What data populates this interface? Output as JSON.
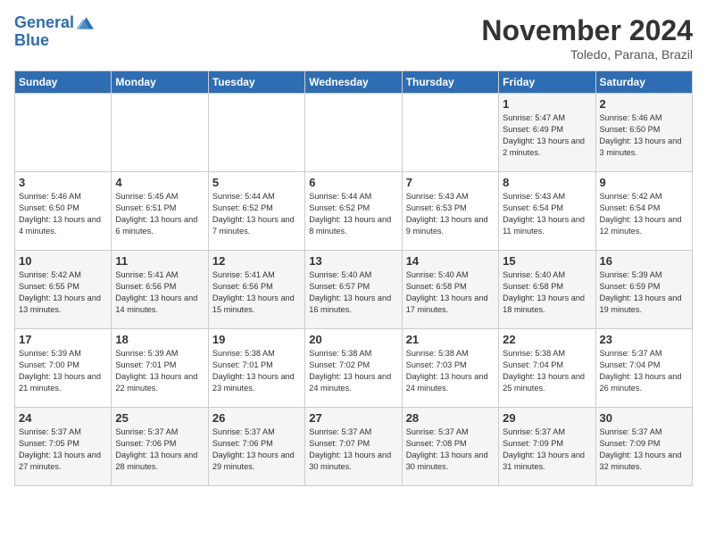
{
  "logo": {
    "line1": "General",
    "line2": "Blue"
  },
  "title": "November 2024",
  "subtitle": "Toledo, Parana, Brazil",
  "days_of_week": [
    "Sunday",
    "Monday",
    "Tuesday",
    "Wednesday",
    "Thursday",
    "Friday",
    "Saturday"
  ],
  "weeks": [
    [
      {
        "day": "",
        "sunrise": "",
        "sunset": "",
        "daylight": ""
      },
      {
        "day": "",
        "sunrise": "",
        "sunset": "",
        "daylight": ""
      },
      {
        "day": "",
        "sunrise": "",
        "sunset": "",
        "daylight": ""
      },
      {
        "day": "",
        "sunrise": "",
        "sunset": "",
        "daylight": ""
      },
      {
        "day": "",
        "sunrise": "",
        "sunset": "",
        "daylight": ""
      },
      {
        "day": "1",
        "sunrise": "Sunrise: 5:47 AM",
        "sunset": "Sunset: 6:49 PM",
        "daylight": "Daylight: 13 hours and 2 minutes."
      },
      {
        "day": "2",
        "sunrise": "Sunrise: 5:46 AM",
        "sunset": "Sunset: 6:50 PM",
        "daylight": "Daylight: 13 hours and 3 minutes."
      }
    ],
    [
      {
        "day": "3",
        "sunrise": "Sunrise: 5:46 AM",
        "sunset": "Sunset: 6:50 PM",
        "daylight": "Daylight: 13 hours and 4 minutes."
      },
      {
        "day": "4",
        "sunrise": "Sunrise: 5:45 AM",
        "sunset": "Sunset: 6:51 PM",
        "daylight": "Daylight: 13 hours and 6 minutes."
      },
      {
        "day": "5",
        "sunrise": "Sunrise: 5:44 AM",
        "sunset": "Sunset: 6:52 PM",
        "daylight": "Daylight: 13 hours and 7 minutes."
      },
      {
        "day": "6",
        "sunrise": "Sunrise: 5:44 AM",
        "sunset": "Sunset: 6:52 PM",
        "daylight": "Daylight: 13 hours and 8 minutes."
      },
      {
        "day": "7",
        "sunrise": "Sunrise: 5:43 AM",
        "sunset": "Sunset: 6:53 PM",
        "daylight": "Daylight: 13 hours and 9 minutes."
      },
      {
        "day": "8",
        "sunrise": "Sunrise: 5:43 AM",
        "sunset": "Sunset: 6:54 PM",
        "daylight": "Daylight: 13 hours and 11 minutes."
      },
      {
        "day": "9",
        "sunrise": "Sunrise: 5:42 AM",
        "sunset": "Sunset: 6:54 PM",
        "daylight": "Daylight: 13 hours and 12 minutes."
      }
    ],
    [
      {
        "day": "10",
        "sunrise": "Sunrise: 5:42 AM",
        "sunset": "Sunset: 6:55 PM",
        "daylight": "Daylight: 13 hours and 13 minutes."
      },
      {
        "day": "11",
        "sunrise": "Sunrise: 5:41 AM",
        "sunset": "Sunset: 6:56 PM",
        "daylight": "Daylight: 13 hours and 14 minutes."
      },
      {
        "day": "12",
        "sunrise": "Sunrise: 5:41 AM",
        "sunset": "Sunset: 6:56 PM",
        "daylight": "Daylight: 13 hours and 15 minutes."
      },
      {
        "day": "13",
        "sunrise": "Sunrise: 5:40 AM",
        "sunset": "Sunset: 6:57 PM",
        "daylight": "Daylight: 13 hours and 16 minutes."
      },
      {
        "day": "14",
        "sunrise": "Sunrise: 5:40 AM",
        "sunset": "Sunset: 6:58 PM",
        "daylight": "Daylight: 13 hours and 17 minutes."
      },
      {
        "day": "15",
        "sunrise": "Sunrise: 5:40 AM",
        "sunset": "Sunset: 6:58 PM",
        "daylight": "Daylight: 13 hours and 18 minutes."
      },
      {
        "day": "16",
        "sunrise": "Sunrise: 5:39 AM",
        "sunset": "Sunset: 6:59 PM",
        "daylight": "Daylight: 13 hours and 19 minutes."
      }
    ],
    [
      {
        "day": "17",
        "sunrise": "Sunrise: 5:39 AM",
        "sunset": "Sunset: 7:00 PM",
        "daylight": "Daylight: 13 hours and 21 minutes."
      },
      {
        "day": "18",
        "sunrise": "Sunrise: 5:39 AM",
        "sunset": "Sunset: 7:01 PM",
        "daylight": "Daylight: 13 hours and 22 minutes."
      },
      {
        "day": "19",
        "sunrise": "Sunrise: 5:38 AM",
        "sunset": "Sunset: 7:01 PM",
        "daylight": "Daylight: 13 hours and 23 minutes."
      },
      {
        "day": "20",
        "sunrise": "Sunrise: 5:38 AM",
        "sunset": "Sunset: 7:02 PM",
        "daylight": "Daylight: 13 hours and 24 minutes."
      },
      {
        "day": "21",
        "sunrise": "Sunrise: 5:38 AM",
        "sunset": "Sunset: 7:03 PM",
        "daylight": "Daylight: 13 hours and 24 minutes."
      },
      {
        "day": "22",
        "sunrise": "Sunrise: 5:38 AM",
        "sunset": "Sunset: 7:04 PM",
        "daylight": "Daylight: 13 hours and 25 minutes."
      },
      {
        "day": "23",
        "sunrise": "Sunrise: 5:37 AM",
        "sunset": "Sunset: 7:04 PM",
        "daylight": "Daylight: 13 hours and 26 minutes."
      }
    ],
    [
      {
        "day": "24",
        "sunrise": "Sunrise: 5:37 AM",
        "sunset": "Sunset: 7:05 PM",
        "daylight": "Daylight: 13 hours and 27 minutes."
      },
      {
        "day": "25",
        "sunrise": "Sunrise: 5:37 AM",
        "sunset": "Sunset: 7:06 PM",
        "daylight": "Daylight: 13 hours and 28 minutes."
      },
      {
        "day": "26",
        "sunrise": "Sunrise: 5:37 AM",
        "sunset": "Sunset: 7:06 PM",
        "daylight": "Daylight: 13 hours and 29 minutes."
      },
      {
        "day": "27",
        "sunrise": "Sunrise: 5:37 AM",
        "sunset": "Sunset: 7:07 PM",
        "daylight": "Daylight: 13 hours and 30 minutes."
      },
      {
        "day": "28",
        "sunrise": "Sunrise: 5:37 AM",
        "sunset": "Sunset: 7:08 PM",
        "daylight": "Daylight: 13 hours and 30 minutes."
      },
      {
        "day": "29",
        "sunrise": "Sunrise: 5:37 AM",
        "sunset": "Sunset: 7:09 PM",
        "daylight": "Daylight: 13 hours and 31 minutes."
      },
      {
        "day": "30",
        "sunrise": "Sunrise: 5:37 AM",
        "sunset": "Sunset: 7:09 PM",
        "daylight": "Daylight: 13 hours and 32 minutes."
      }
    ]
  ]
}
